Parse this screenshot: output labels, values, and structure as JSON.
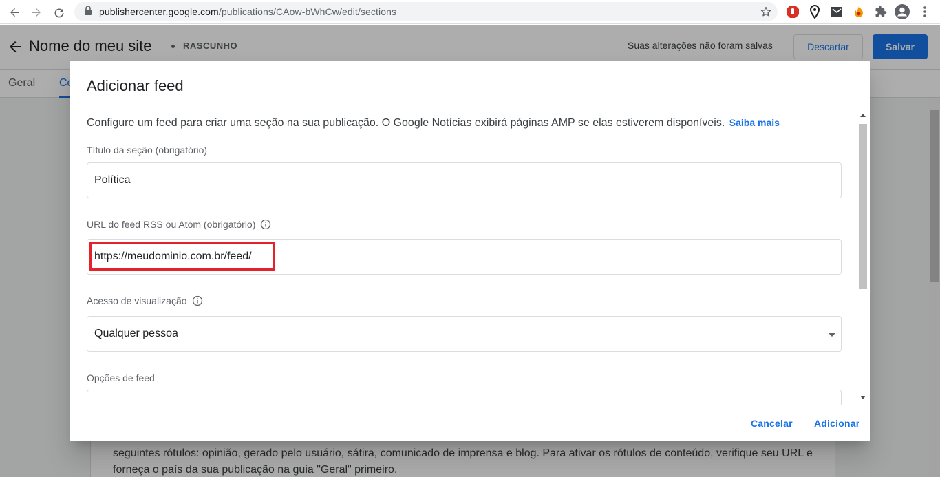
{
  "browser": {
    "url_host": "publishercenter.google.com",
    "url_path": "/publications/CAow-bWhCw/edit/sections",
    "icons": [
      "back-icon",
      "forward-icon",
      "reload-icon",
      "lock-icon",
      "star-icon",
      "adblock-icon",
      "location-pin-icon",
      "mail-extension-icon",
      "fire-extension-icon",
      "puzzle-icon",
      "profile-icon",
      "more-vert-icon"
    ]
  },
  "app": {
    "site_title": "Nome do meu site",
    "status": "RASCUNHO",
    "unsaved_message": "Suas alterações não foram salvas",
    "discard_label": "Descartar",
    "save_label": "Salvar",
    "tabs": [
      {
        "label": "Geral"
      },
      {
        "label": "Co"
      }
    ],
    "background_text": "seguintes rótulos: opinião, gerado pelo usuário, sátira, comunicado de imprensa e blog. Para ativar os rótulos de conteúdo, verifique seu URL e forneça o país da sua publicação na guia \"Geral\" primeiro."
  },
  "dialog": {
    "title": "Adicionar feed",
    "description": "Configure um feed para criar uma seção na sua publicação. O Google Notícias exibirá páginas AMP se elas estiverem disponíveis.",
    "learn_more": "Saiba mais",
    "section_title_label": "Título da seção (obrigatório)",
    "section_title_value": "Política",
    "feed_url_label": "URL do feed RSS ou Atom (obrigatório)",
    "feed_url_value": "https://meudominio.com.br/feed/",
    "access_label": "Acesso de visualização",
    "access_value": "Qualquer pessoa",
    "feed_options_label": "Opções de feed",
    "cancel_label": "Cancelar",
    "add_label": "Adicionar"
  },
  "colors": {
    "accent": "#1a73e8",
    "highlight_border": "#e5212c"
  }
}
